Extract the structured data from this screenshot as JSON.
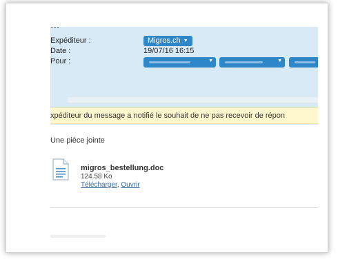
{
  "header": {
    "title_cutoff": "...",
    "sender_label": "Expéditeur :",
    "sender_value": "Migros.ch",
    "date_label": "Date :",
    "date_value": "19/07/16 16:15",
    "to_label": "Pour :",
    "recipients": [
      "recipient-1",
      "recipient-2",
      "recipient-3"
    ]
  },
  "notice": {
    "text": "xpéditeur du message a notifié le souhait de ne pas recevoir de répon"
  },
  "attachments": {
    "heading": "Une pièce jointe",
    "file_name": "migros_bestellung.doc",
    "file_size": "124.58 Ko",
    "download_label": "Télécharger",
    "separator": ", ",
    "open_label": "Ouvrir"
  },
  "colors": {
    "header_bg": "#d7eaf6",
    "chip_blue": "#2d87c8",
    "notice_bg": "#fff8cf",
    "link": "#3a6ea5"
  }
}
